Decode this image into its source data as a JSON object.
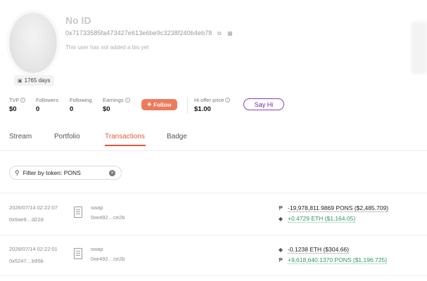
{
  "profile": {
    "name": "No ID",
    "address": "0x71733585fa473427e613e6be9c3238f240b4eb78",
    "bio": "This user has not added a bio yet",
    "days": "1765 days"
  },
  "stats": {
    "tvf": {
      "label": "TVF",
      "value": "$0"
    },
    "followers": {
      "label": "Followers",
      "value": "0"
    },
    "following": {
      "label": "Following",
      "value": "0"
    },
    "earnings": {
      "label": "Earnings",
      "value": "$0"
    },
    "follow_label": "Follow",
    "hi_offer": {
      "label": "Hi offer price",
      "value": "$1.00"
    },
    "say_hi_label": "Say Hi"
  },
  "tabs": [
    "Stream",
    "Portfolio",
    "Transactions",
    "Badge"
  ],
  "active_tab": "Transactions",
  "filter": {
    "text": "Filter by token: PONS"
  },
  "transactions": [
    {
      "datetime": "2026/07/14 02:22:07",
      "hash": "0x9ae9…d22d",
      "method": "swap",
      "to": "0xe492…ce2b",
      "out": "-19,978,811.9869 PONS ($2,485.709)",
      "in": "+0.4729 ETH ($1,164.05)",
      "out_icon": "pons-token-icon",
      "in_icon": "eth-icon"
    },
    {
      "datetime": "2026/07/14 02:22:01",
      "hash": "0x5247…b95b",
      "method": "swap",
      "to": "0xe492…ce2b",
      "out": "-0.1238 ETH ($304.66)",
      "in": "+9,618,640.1370 PONS ($1,196.725)",
      "out_icon": "eth-icon",
      "in_icon": "pons-token-icon"
    }
  ],
  "colors": {
    "accent": "#e4583e",
    "follow_bg": "#f0795b",
    "say_hi_border": "#8b3fc1",
    "positive": "#2c9a5c"
  }
}
